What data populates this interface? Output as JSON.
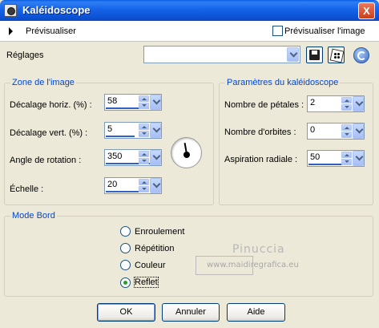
{
  "window": {
    "title": "Kaléidoscope",
    "close_label": "X"
  },
  "preview": {
    "label": "Prévisualiser",
    "checkbox_label": "Prévisualiser l'image",
    "checked": false
  },
  "presets": {
    "label": "Réglages",
    "value": ""
  },
  "image_zone": {
    "legend": "Zone de l'image",
    "fields": [
      {
        "label": "Décalage horiz. (%) :",
        "value": "58",
        "fill": 0.79
      },
      {
        "label": "Décalage vert. (%) :",
        "value": "5",
        "fill": 0.525
      },
      {
        "label": "Angle de rotation :",
        "value": "350",
        "fill": 0.97
      },
      {
        "label": "Échelle :",
        "value": "20",
        "fill": 0.6
      }
    ],
    "dial_angle_deg": 350
  },
  "kaleido_params": {
    "legend": "Paramètres du kaléidoscope",
    "fields": [
      {
        "label": "Nombre de pétales :",
        "value": "2",
        "fill": 0.0
      },
      {
        "label": "Nombre d'orbites :",
        "value": "0",
        "fill": 0.0
      },
      {
        "label": "Aspiration radiale :",
        "value": "50",
        "fill": 0.75
      }
    ]
  },
  "edge_mode": {
    "legend": "Mode Bord",
    "options": [
      {
        "label": "Enroulement",
        "checked": false
      },
      {
        "label": "Répétition",
        "checked": false
      },
      {
        "label": "Couleur",
        "checked": false
      },
      {
        "label": "Reflet",
        "checked": true
      }
    ]
  },
  "watermark": {
    "name": "Pinuccia",
    "url": "www.maidiregrafica.eu"
  },
  "buttons": {
    "ok": "OK",
    "cancel": "Annuler",
    "help": "Aide"
  },
  "icons": {
    "save": "save-icon",
    "random": "dice-icon",
    "reset": "reset-icon"
  }
}
